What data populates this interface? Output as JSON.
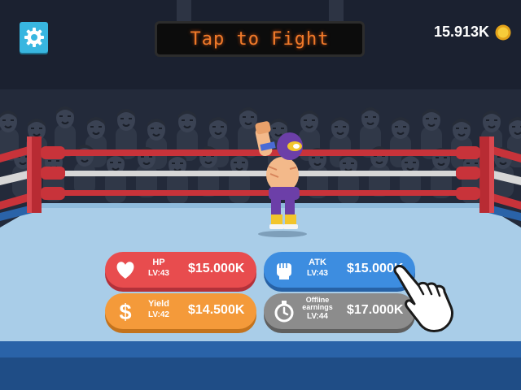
{
  "header": {
    "sign_text": "Tap to Fight",
    "coins": "15.913K"
  },
  "upgrades": [
    {
      "name": "HP",
      "level": "LV:43",
      "price": "$15.000K",
      "icon": "heart-icon",
      "color": "#e84c4e"
    },
    {
      "name": "ATK",
      "level": "LV:43",
      "price": "$15.000K",
      "icon": "fist-icon",
      "color": "#3d8de0"
    },
    {
      "name": "Yield",
      "level": "LV:42",
      "price": "$14.500K",
      "icon": "dollar-icon",
      "color": "#f49a3a"
    },
    {
      "name_line1": "Offline",
      "name_line2": "earnings",
      "level": "LV:44",
      "price": "$17.000K",
      "icon": "stopwatch-icon",
      "color": "#8c8c8c"
    }
  ],
  "icons": [
    "gear-icon",
    "coin-icon",
    "heart-icon",
    "fist-icon",
    "dollar-icon",
    "stopwatch-icon",
    "pointing-hand-icon"
  ]
}
